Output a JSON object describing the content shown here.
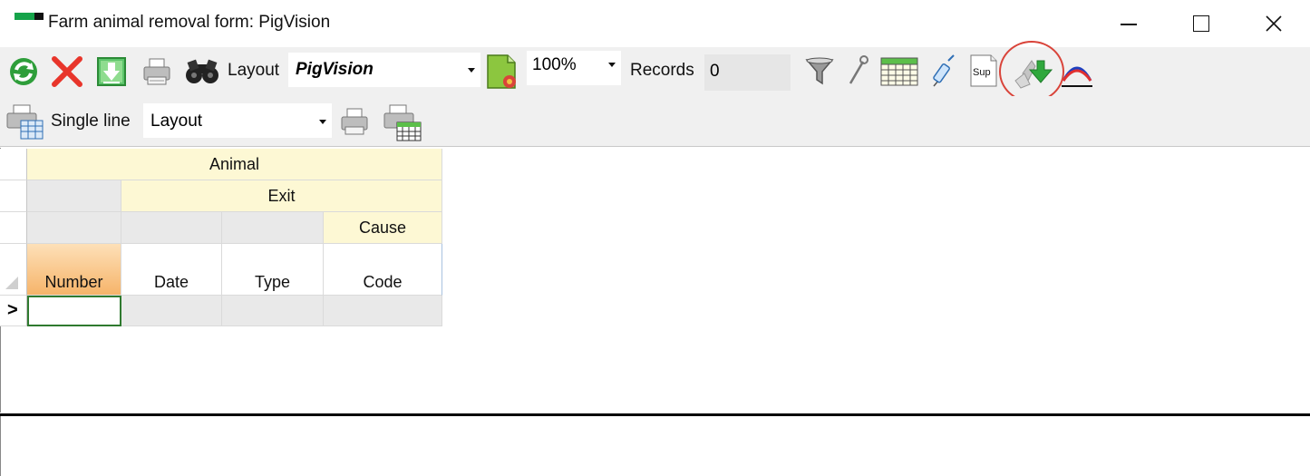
{
  "window": {
    "title": "Farm animal removal form: PigVision"
  },
  "toolbar1": {
    "layout_label": "Layout",
    "layout_value": "PigVision",
    "zoom_value": "100%",
    "records_label": "Records",
    "records_value": "0",
    "sup_label": "Sup"
  },
  "toolbar2": {
    "single_line_label": "Single line",
    "layout_value": "Layout"
  },
  "grid": {
    "group_animal": "Animal",
    "group_exit": "Exit",
    "group_cause": "Cause",
    "columns": [
      "Number",
      "Date",
      "Type",
      "Code"
    ],
    "row_indicator": ">"
  },
  "colors": {
    "highlight_circle": "#d9443a",
    "header_yellow": "#fdf8d4",
    "number_header_orange": "#f6b46a",
    "active_cell_border": "#2f7a2f"
  },
  "icons": [
    "refresh-icon",
    "delete-icon",
    "download-icon",
    "print-icon",
    "binoculars-icon",
    "layout-settings-icon",
    "filter-icon",
    "wrench-icon",
    "calendar-icon",
    "syringe-icon",
    "sup-icon",
    "recycle-icon",
    "curve-chart-icon",
    "print-preview-icon",
    "printer-icon",
    "print-table-icon"
  ]
}
